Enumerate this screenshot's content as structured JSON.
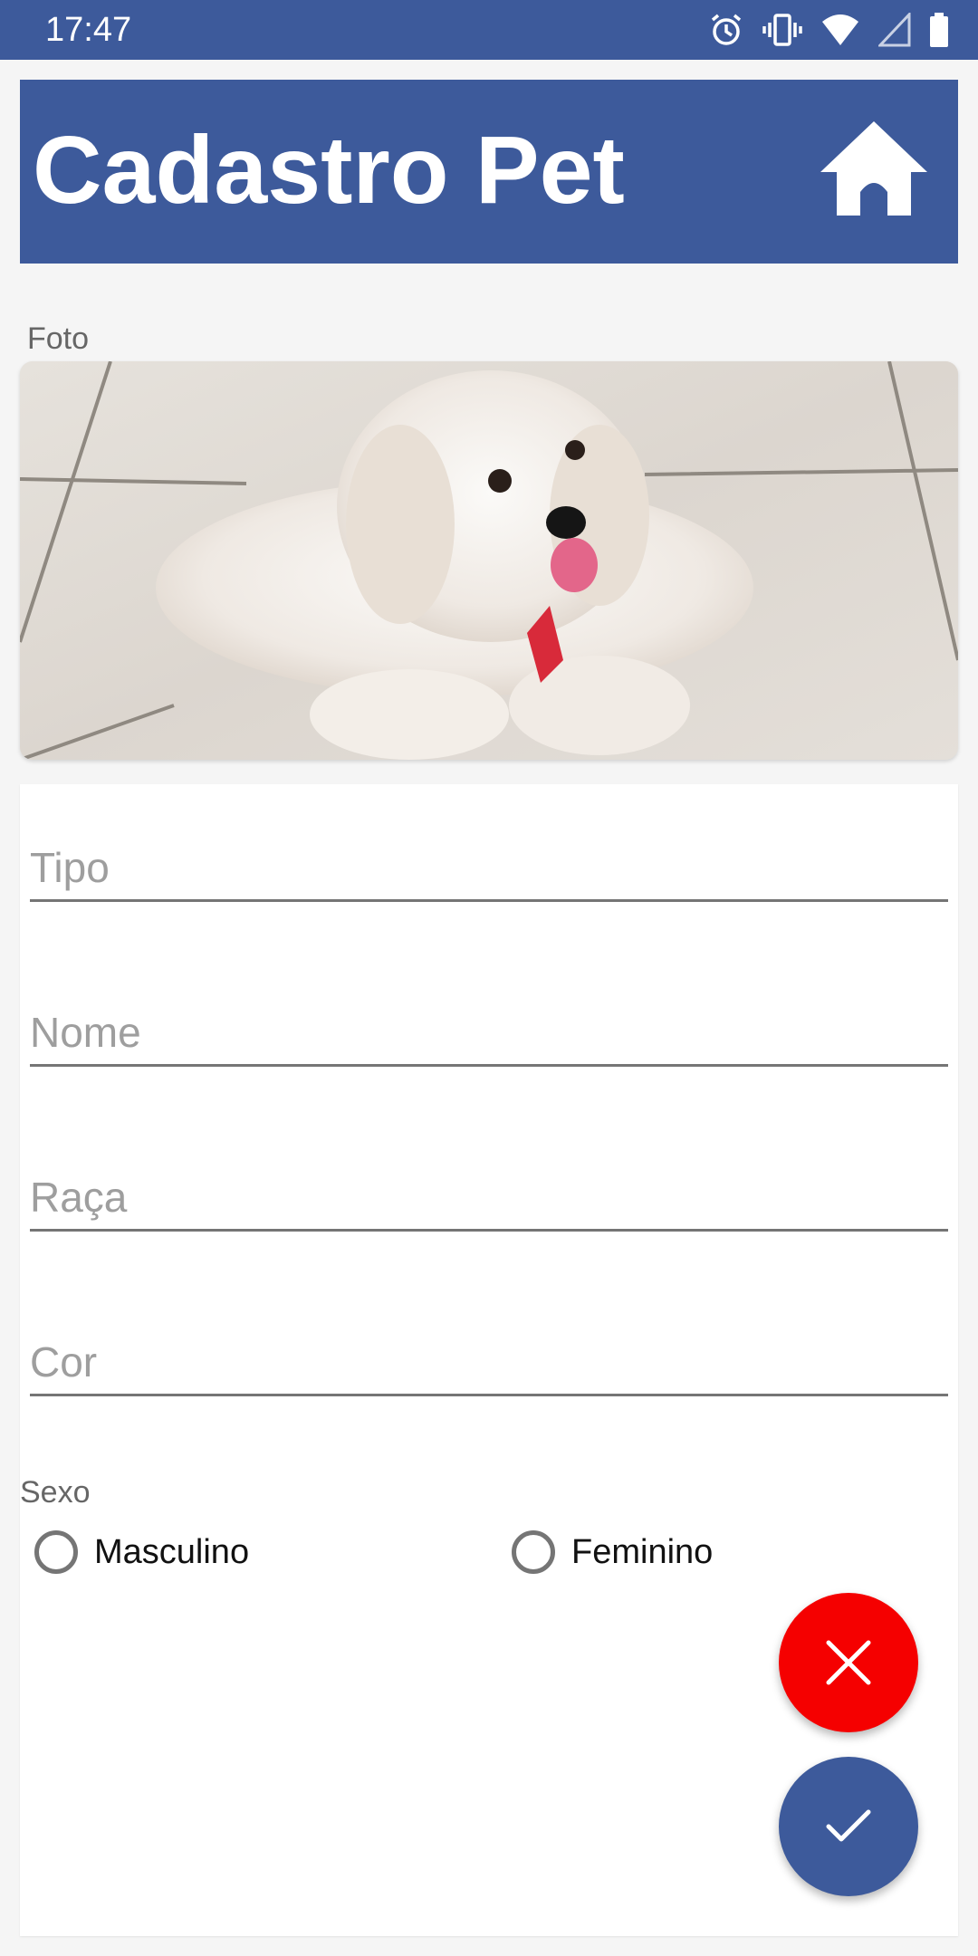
{
  "status_bar": {
    "time": "17:47",
    "icons": [
      "alarm-icon",
      "vibrate-icon",
      "wifi-icon",
      "signal-icon",
      "battery-icon"
    ]
  },
  "header": {
    "title": "Cadastro Pet",
    "home_icon": "home-icon",
    "background_color": "#3d5a9b"
  },
  "photo_section": {
    "label": "Foto"
  },
  "form": {
    "tipo": {
      "value": "",
      "placeholder": "Tipo"
    },
    "nome": {
      "value": "",
      "placeholder": "Nome"
    },
    "raca": {
      "value": "",
      "placeholder": "Raça"
    },
    "cor": {
      "value": "",
      "placeholder": "Cor"
    },
    "sexo": {
      "label": "Sexo",
      "options": [
        "Masculino",
        "Feminino"
      ],
      "selected": null
    }
  },
  "actions": {
    "cancel_icon": "close-icon",
    "cancel_color": "#f50000",
    "confirm_icon": "check-icon",
    "confirm_color": "#3d5a9b"
  }
}
